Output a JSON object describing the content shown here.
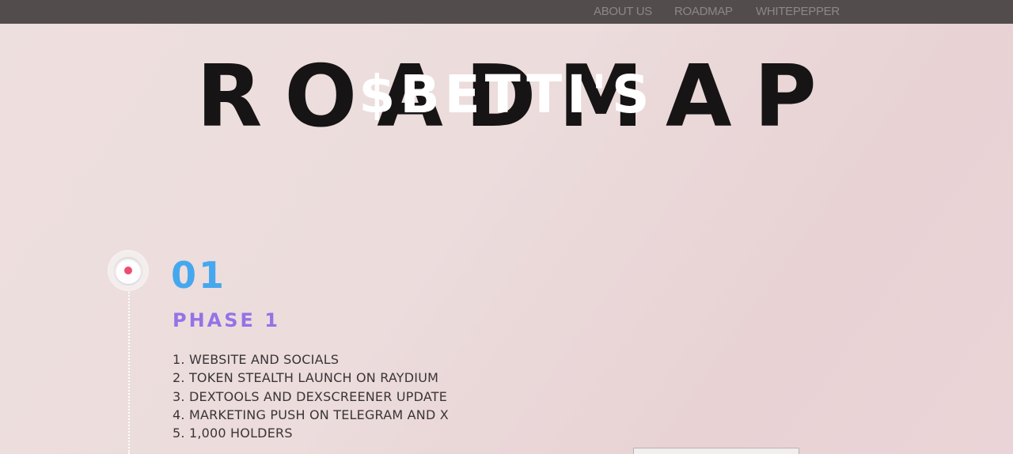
{
  "nav": {
    "items": [
      {
        "label": "ABOUT US"
      },
      {
        "label": "ROADMAP"
      },
      {
        "label": "WHITEPEPPER"
      }
    ]
  },
  "hero": {
    "title": "ROADMAP",
    "overlay": "$BETTI'S"
  },
  "phases": [
    {
      "number": "01",
      "title": "PHASE 1",
      "items": [
        "1. WEBSITE AND SOCIALS",
        "2. TOKEN STEALTH LAUNCH ON RAYDIUM",
        "3. DEXTOOLS AND DEXSCREENER UPDATE",
        "4. MARKETING PUSH ON TELEGRAM AND X",
        "5. 1,000 HOLDERS"
      ]
    }
  ],
  "colors": {
    "topbar": "#524c4c",
    "nav_text": "#8d8789",
    "hero_title": "#161414",
    "hero_overlay": "#ffffff",
    "phase_number": "#45a8ee",
    "phase_title": "#9473e6",
    "timeline_dot": "#ee4c6f",
    "body_text": "#3a3536"
  },
  "icons": {
    "timeline_node": "timeline-node-icon"
  }
}
